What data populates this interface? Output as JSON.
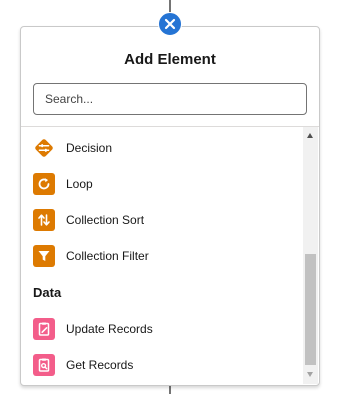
{
  "dialog": {
    "title": "Add Element",
    "search_placeholder": "Search..."
  },
  "items": [
    {
      "label": "Decision",
      "icon": "decision-icon",
      "color": "#dd7a01"
    },
    {
      "label": "Loop",
      "icon": "loop-icon",
      "color": "#dd7a01"
    },
    {
      "label": "Collection Sort",
      "icon": "sort-icon",
      "color": "#dd7a01"
    },
    {
      "label": "Collection Filter",
      "icon": "filter-icon",
      "color": "#dd7a01"
    }
  ],
  "data_section": {
    "title": "Data",
    "items": [
      {
        "label": "Update Records",
        "icon": "update-records-icon",
        "color": "#f35d8a"
      },
      {
        "label": "Get Records",
        "icon": "get-records-icon",
        "color": "#f35d8a"
      }
    ]
  },
  "colors": {
    "close_button": "#2574d4",
    "logic_orange": "#dd7a01",
    "data_pink": "#f35d8a"
  }
}
